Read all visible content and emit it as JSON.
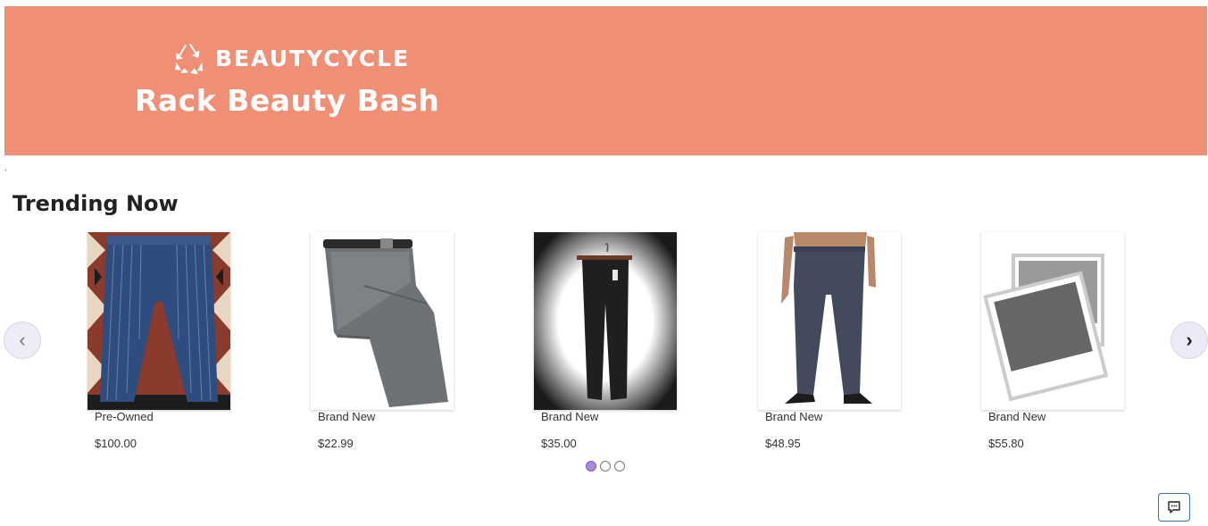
{
  "banner": {
    "brand_name": "BEAUTYCYCLE",
    "title": "Rack Beauty Bash",
    "logo_icon": "recycle-icon",
    "background_color": "#ef8f76"
  },
  "stray_mark": ".",
  "trending": {
    "title": "Trending Now",
    "prev_arrow": "‹",
    "next_arrow": "›",
    "products": [
      {
        "condition": "Pre-Owned",
        "price": "$100.00",
        "image": "striped-denim-jeans"
      },
      {
        "condition": "Brand New",
        "price": "$22.99",
        "image": "folded-grey-trousers"
      },
      {
        "condition": "Brand New",
        "price": "$35.00",
        "image": "black-pants-on-hanger"
      },
      {
        "condition": "Brand New",
        "price": "$48.95",
        "image": "model-in-navy-pants"
      },
      {
        "condition": "Brand New",
        "price": "$55.80",
        "image": "photo-placeholder"
      }
    ],
    "pager": {
      "pages": 3,
      "active": 1
    }
  },
  "chat": {
    "icon": "chat-icon"
  }
}
